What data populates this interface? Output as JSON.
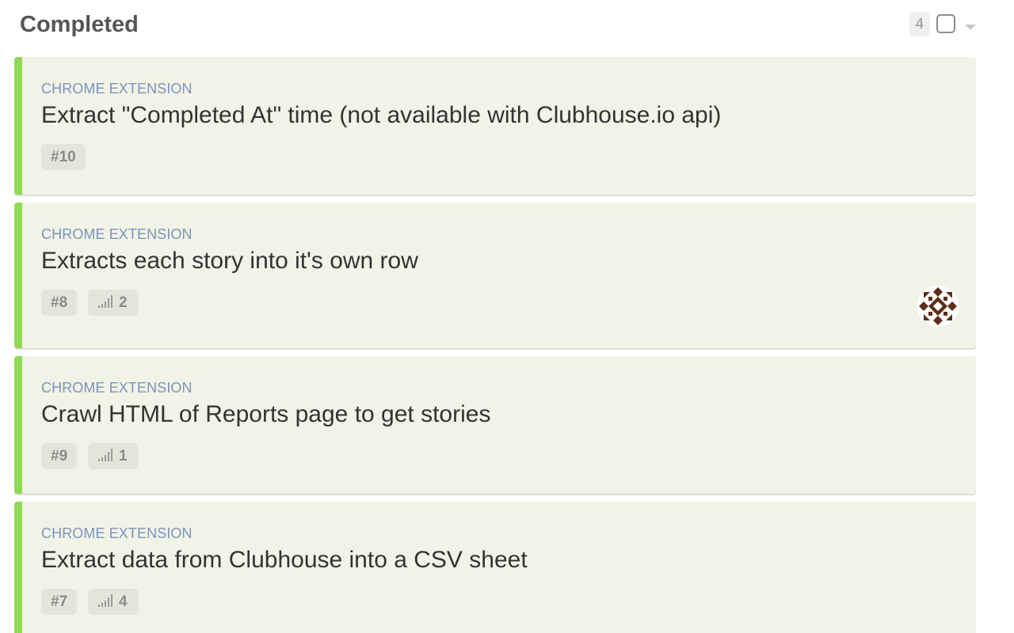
{
  "column": {
    "title": "Completed",
    "count": "4"
  },
  "theme": {
    "card_background": "#f0f3e6",
    "state_bar_color": "#8fd957",
    "story_type_color": "#7d93ba",
    "avatar_color": "#5b2e1b"
  },
  "stories": [
    {
      "type": "CHROME EXTENSION",
      "title": "Extract \"Completed At\" time (not available with Clubhouse.io api)",
      "id": "#10",
      "estimate": null,
      "estimate_icon": "estimate-bars-icon",
      "has_avatar": false
    },
    {
      "type": "CHROME EXTENSION",
      "title": "Extracts each story into it's own row",
      "id": "#8",
      "estimate": "2",
      "estimate_icon": "estimate-bars-icon",
      "has_avatar": true
    },
    {
      "type": "CHROME EXTENSION",
      "title": "Crawl HTML of Reports page to get stories",
      "id": "#9",
      "estimate": "1",
      "estimate_icon": "estimate-bars-icon",
      "has_avatar": false
    },
    {
      "type": "CHROME EXTENSION",
      "title": "Extract data from Clubhouse into a CSV sheet",
      "id": "#7",
      "estimate": "4",
      "estimate_icon": "estimate-bars-icon",
      "has_avatar": false
    }
  ]
}
